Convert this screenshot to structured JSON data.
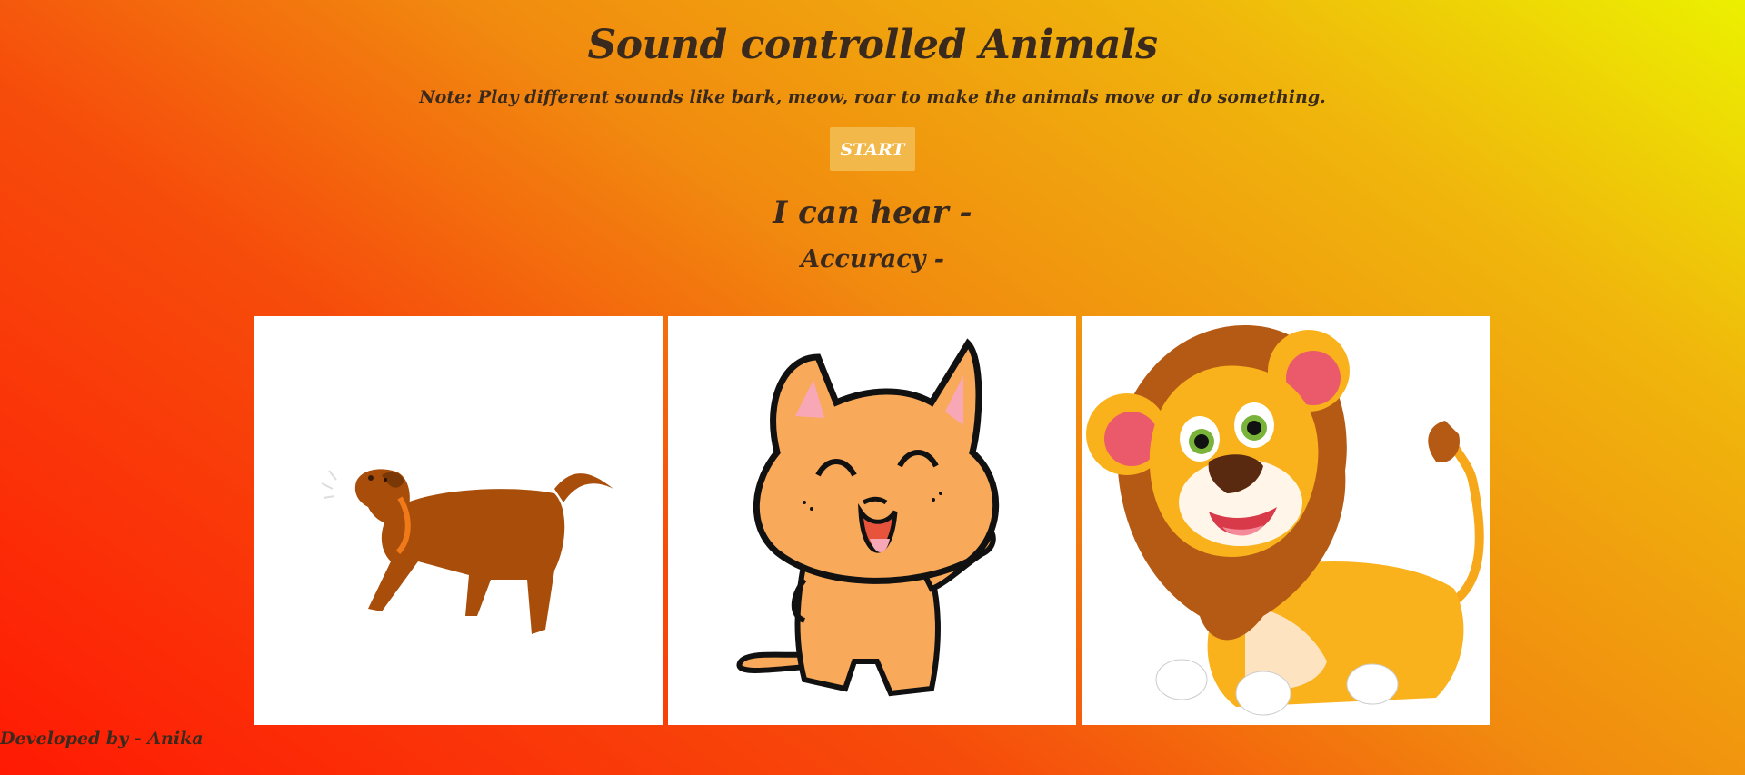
{
  "header": {
    "title": "Sound controlled Animals",
    "note": "Note: Play different sounds like bark, meow, roar to make the animals move or do something."
  },
  "controls": {
    "start_label": "START"
  },
  "status": {
    "hear_label": "I can hear -",
    "accuracy_label": "Accuracy -"
  },
  "animals": [
    {
      "name": "dog-image"
    },
    {
      "name": "cat-image"
    },
    {
      "name": "lion-image"
    }
  ],
  "footer": {
    "credit": "Developed by - Anika"
  },
  "colors": {
    "gradient_start": "#ff1a04",
    "gradient_end": "#ecf000",
    "text": "#3a2a1e",
    "button_bg": "#f2b84a",
    "button_text": "#ffffff"
  }
}
